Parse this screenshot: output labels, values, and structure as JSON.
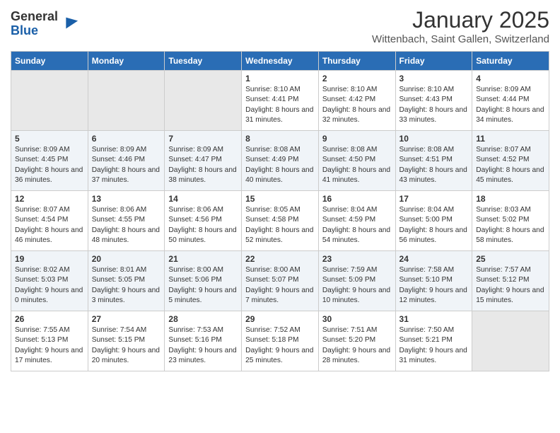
{
  "header": {
    "logo_general": "General",
    "logo_blue": "Blue",
    "month_title": "January 2025",
    "location": "Wittenbach, Saint Gallen, Switzerland"
  },
  "days_of_week": [
    "Sunday",
    "Monday",
    "Tuesday",
    "Wednesday",
    "Thursday",
    "Friday",
    "Saturday"
  ],
  "weeks": [
    [
      {
        "day": "",
        "empty": true
      },
      {
        "day": "",
        "empty": true
      },
      {
        "day": "",
        "empty": true
      },
      {
        "day": "1",
        "sunrise": "8:10 AM",
        "sunset": "4:41 PM",
        "daylight": "8 hours and 31 minutes."
      },
      {
        "day": "2",
        "sunrise": "8:10 AM",
        "sunset": "4:42 PM",
        "daylight": "8 hours and 32 minutes."
      },
      {
        "day": "3",
        "sunrise": "8:10 AM",
        "sunset": "4:43 PM",
        "daylight": "8 hours and 33 minutes."
      },
      {
        "day": "4",
        "sunrise": "8:09 AM",
        "sunset": "4:44 PM",
        "daylight": "8 hours and 34 minutes."
      }
    ],
    [
      {
        "day": "5",
        "sunrise": "8:09 AM",
        "sunset": "4:45 PM",
        "daylight": "8 hours and 36 minutes."
      },
      {
        "day": "6",
        "sunrise": "8:09 AM",
        "sunset": "4:46 PM",
        "daylight": "8 hours and 37 minutes."
      },
      {
        "day": "7",
        "sunrise": "8:09 AM",
        "sunset": "4:47 PM",
        "daylight": "8 hours and 38 minutes."
      },
      {
        "day": "8",
        "sunrise": "8:08 AM",
        "sunset": "4:49 PM",
        "daylight": "8 hours and 40 minutes."
      },
      {
        "day": "9",
        "sunrise": "8:08 AM",
        "sunset": "4:50 PM",
        "daylight": "8 hours and 41 minutes."
      },
      {
        "day": "10",
        "sunrise": "8:08 AM",
        "sunset": "4:51 PM",
        "daylight": "8 hours and 43 minutes."
      },
      {
        "day": "11",
        "sunrise": "8:07 AM",
        "sunset": "4:52 PM",
        "daylight": "8 hours and 45 minutes."
      }
    ],
    [
      {
        "day": "12",
        "sunrise": "8:07 AM",
        "sunset": "4:54 PM",
        "daylight": "8 hours and 46 minutes."
      },
      {
        "day": "13",
        "sunrise": "8:06 AM",
        "sunset": "4:55 PM",
        "daylight": "8 hours and 48 minutes."
      },
      {
        "day": "14",
        "sunrise": "8:06 AM",
        "sunset": "4:56 PM",
        "daylight": "8 hours and 50 minutes."
      },
      {
        "day": "15",
        "sunrise": "8:05 AM",
        "sunset": "4:58 PM",
        "daylight": "8 hours and 52 minutes."
      },
      {
        "day": "16",
        "sunrise": "8:04 AM",
        "sunset": "4:59 PM",
        "daylight": "8 hours and 54 minutes."
      },
      {
        "day": "17",
        "sunrise": "8:04 AM",
        "sunset": "5:00 PM",
        "daylight": "8 hours and 56 minutes."
      },
      {
        "day": "18",
        "sunrise": "8:03 AM",
        "sunset": "5:02 PM",
        "daylight": "8 hours and 58 minutes."
      }
    ],
    [
      {
        "day": "19",
        "sunrise": "8:02 AM",
        "sunset": "5:03 PM",
        "daylight": "9 hours and 0 minutes."
      },
      {
        "day": "20",
        "sunrise": "8:01 AM",
        "sunset": "5:05 PM",
        "daylight": "9 hours and 3 minutes."
      },
      {
        "day": "21",
        "sunrise": "8:00 AM",
        "sunset": "5:06 PM",
        "daylight": "9 hours and 5 minutes."
      },
      {
        "day": "22",
        "sunrise": "8:00 AM",
        "sunset": "5:07 PM",
        "daylight": "9 hours and 7 minutes."
      },
      {
        "day": "23",
        "sunrise": "7:59 AM",
        "sunset": "5:09 PM",
        "daylight": "9 hours and 10 minutes."
      },
      {
        "day": "24",
        "sunrise": "7:58 AM",
        "sunset": "5:10 PM",
        "daylight": "9 hours and 12 minutes."
      },
      {
        "day": "25",
        "sunrise": "7:57 AM",
        "sunset": "5:12 PM",
        "daylight": "9 hours and 15 minutes."
      }
    ],
    [
      {
        "day": "26",
        "sunrise": "7:55 AM",
        "sunset": "5:13 PM",
        "daylight": "9 hours and 17 minutes."
      },
      {
        "day": "27",
        "sunrise": "7:54 AM",
        "sunset": "5:15 PM",
        "daylight": "9 hours and 20 minutes."
      },
      {
        "day": "28",
        "sunrise": "7:53 AM",
        "sunset": "5:16 PM",
        "daylight": "9 hours and 23 minutes."
      },
      {
        "day": "29",
        "sunrise": "7:52 AM",
        "sunset": "5:18 PM",
        "daylight": "9 hours and 25 minutes."
      },
      {
        "day": "30",
        "sunrise": "7:51 AM",
        "sunset": "5:20 PM",
        "daylight": "9 hours and 28 minutes."
      },
      {
        "day": "31",
        "sunrise": "7:50 AM",
        "sunset": "5:21 PM",
        "daylight": "9 hours and 31 minutes."
      },
      {
        "day": "",
        "empty": true
      }
    ]
  ],
  "labels": {
    "sunrise": "Sunrise:",
    "sunset": "Sunset:",
    "daylight": "Daylight hours"
  }
}
